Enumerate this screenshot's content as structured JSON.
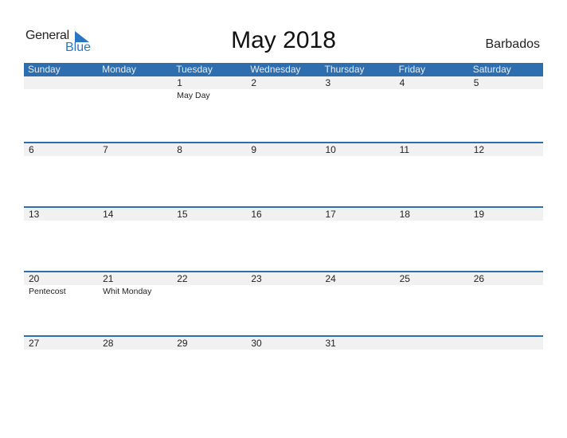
{
  "logo": {
    "word1": "General",
    "word2": "Blue",
    "icon": "triangle-flag-icon",
    "color": "#2a77c1"
  },
  "title": "May 2018",
  "country": "Barbados",
  "colors": {
    "header_bg": "#2e6eaf",
    "strip_bg": "#f1f1f1"
  },
  "weekdays": [
    "Sunday",
    "Monday",
    "Tuesday",
    "Wednesday",
    "Thursday",
    "Friday",
    "Saturday"
  ],
  "weeks": [
    [
      {
        "d": ""
      },
      {
        "d": ""
      },
      {
        "d": "1",
        "h": "May Day"
      },
      {
        "d": "2"
      },
      {
        "d": "3"
      },
      {
        "d": "4"
      },
      {
        "d": "5"
      }
    ],
    [
      {
        "d": "6"
      },
      {
        "d": "7"
      },
      {
        "d": "8"
      },
      {
        "d": "9"
      },
      {
        "d": "10"
      },
      {
        "d": "11"
      },
      {
        "d": "12"
      }
    ],
    [
      {
        "d": "13"
      },
      {
        "d": "14"
      },
      {
        "d": "15"
      },
      {
        "d": "16"
      },
      {
        "d": "17"
      },
      {
        "d": "18"
      },
      {
        "d": "19"
      }
    ],
    [
      {
        "d": "20",
        "h": "Pentecost"
      },
      {
        "d": "21",
        "h": "Whit Monday"
      },
      {
        "d": "22"
      },
      {
        "d": "23"
      },
      {
        "d": "24"
      },
      {
        "d": "25"
      },
      {
        "d": "26"
      }
    ],
    [
      {
        "d": "27"
      },
      {
        "d": "28"
      },
      {
        "d": "29"
      },
      {
        "d": "30"
      },
      {
        "d": "31"
      },
      {
        "d": ""
      },
      {
        "d": ""
      }
    ]
  ]
}
